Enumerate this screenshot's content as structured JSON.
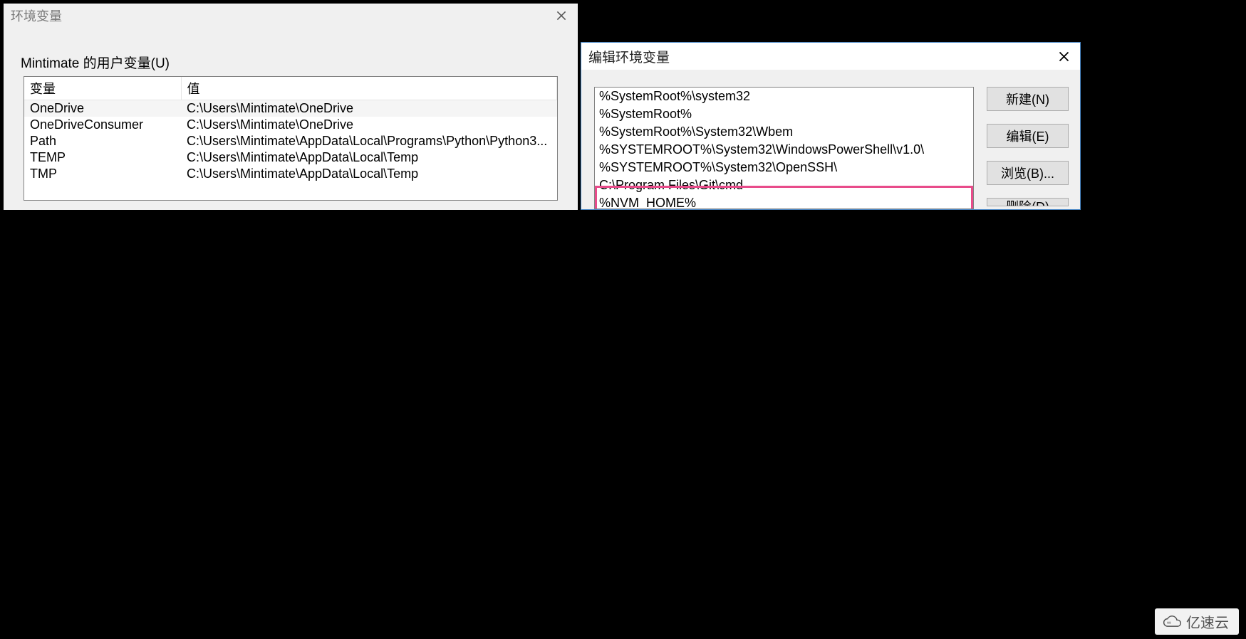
{
  "envDialog": {
    "title": "环境变量",
    "sectionLabel": "Mintimate 的用户变量(U)",
    "columns": {
      "name": "变量",
      "value": "值"
    },
    "rows": [
      {
        "name": "OneDrive",
        "value": "C:\\Users\\Mintimate\\OneDrive",
        "selected": true
      },
      {
        "name": "OneDriveConsumer",
        "value": "C:\\Users\\Mintimate\\OneDrive"
      },
      {
        "name": "Path",
        "value": "C:\\Users\\Mintimate\\AppData\\Local\\Programs\\Python\\Python3..."
      },
      {
        "name": "TEMP",
        "value": "C:\\Users\\Mintimate\\AppData\\Local\\Temp"
      },
      {
        "name": "TMP",
        "value": "C:\\Users\\Mintimate\\AppData\\Local\\Temp"
      }
    ]
  },
  "editDialog": {
    "title": "编辑环境变量",
    "items": [
      "%SystemRoot%\\system32",
      "%SystemRoot%",
      "%SystemRoot%\\System32\\Wbem",
      "%SYSTEMROOT%\\System32\\WindowsPowerShell\\v1.0\\",
      "%SYSTEMROOT%\\System32\\OpenSSH\\",
      "C:\\Program Files\\Git\\cmd",
      "%NVM_HOME%"
    ],
    "buttons": {
      "new": "新建(N)",
      "edit": "编辑(E)",
      "browse": "浏览(B)...",
      "delete": "删除(D)"
    }
  },
  "watermark": "亿速云"
}
